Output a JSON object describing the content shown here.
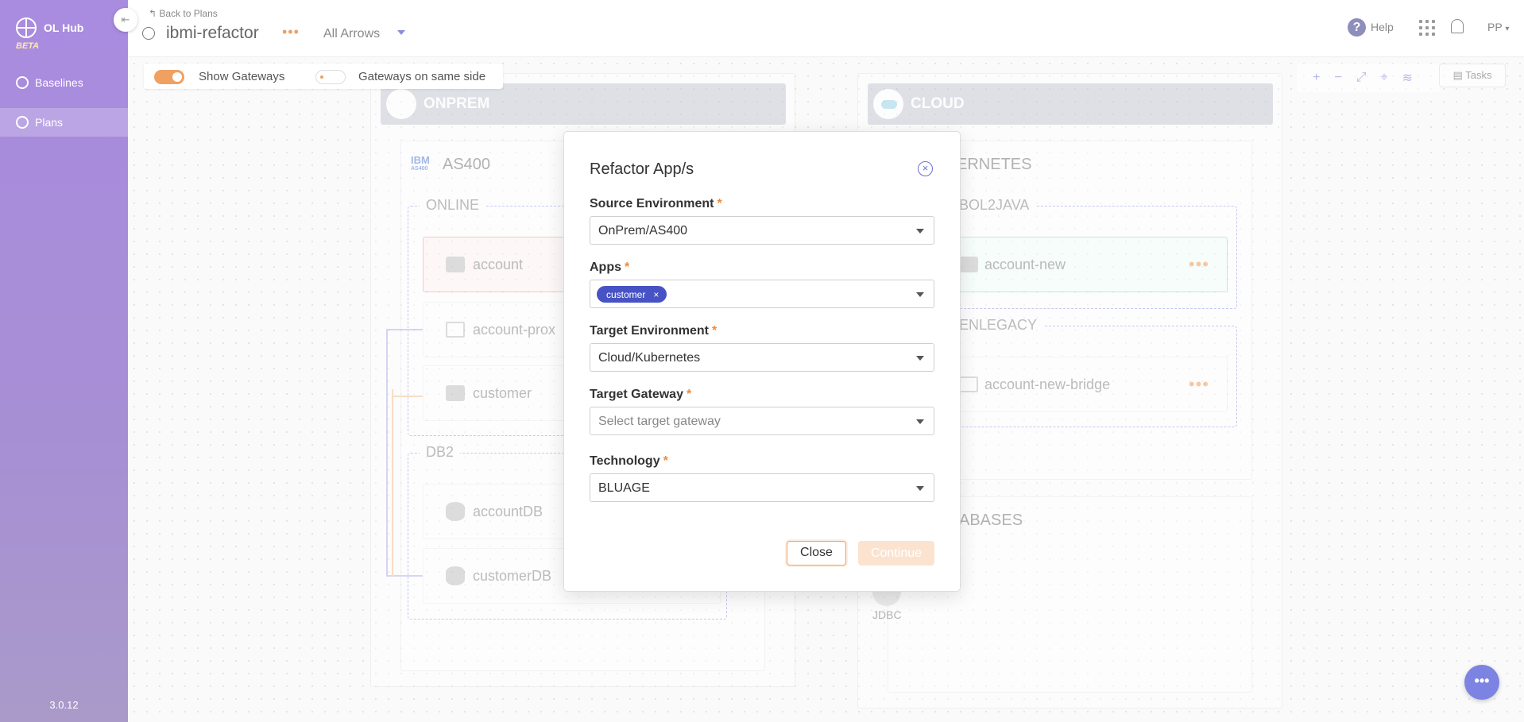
{
  "sidebar": {
    "brand_name": "OL Hub",
    "beta_label": "BETA",
    "items": [
      {
        "label": "Baselines",
        "active": false
      },
      {
        "label": "Plans",
        "active": true
      }
    ],
    "version": "3.0.12"
  },
  "header": {
    "back_link": "Back to Plans",
    "plan_title": "ibmi-refactor",
    "arrow_filter": "All Arrows",
    "help_label": "Help",
    "user_initials": "PP"
  },
  "toolbar": {
    "show_gateways_label": "Show Gateways",
    "show_gateways_on": true,
    "same_side_label": "Gateways on same side",
    "same_side_on": false,
    "tasks_label": "Tasks"
  },
  "diagram": {
    "onprem": {
      "label": "ONPREM",
      "platform": "AS400",
      "groups": [
        {
          "label": "ONLINE",
          "apps": [
            "account",
            "account-prox",
            "customer"
          ]
        },
        {
          "label": "DB2",
          "apps": [
            "accountDB",
            "customerDB"
          ]
        }
      ]
    },
    "cloud": {
      "label": "CLOUD",
      "platform_partial": "ERNETES",
      "groups": [
        {
          "label": "BOL2JAVA",
          "apps": [
            "account-new"
          ]
        },
        {
          "label": "ENLEGACY",
          "apps": [
            "account-new-bridge"
          ]
        }
      ],
      "databases_partial": "ABASES",
      "jdbc_label": "JDBC"
    },
    "ibm_logo_text": "IBM",
    "ibm_logo_subtext": "AS400"
  },
  "dialog": {
    "title": "Refactor App/s",
    "required_mark": "*",
    "source_env": {
      "label": "Source Environment",
      "value": "OnPrem/AS400"
    },
    "apps": {
      "label": "Apps",
      "chips": [
        "customer"
      ]
    },
    "target_env": {
      "label": "Target Environment",
      "value": "Cloud/Kubernetes"
    },
    "target_gateway": {
      "label": "Target Gateway",
      "placeholder": "Select target gateway"
    },
    "technology": {
      "label": "Technology",
      "value": "BLUAGE"
    },
    "close_label": "Close",
    "continue_label": "Continue"
  },
  "icons": {
    "back": "↰",
    "close": "×",
    "more": "•••",
    "fab": "•••",
    "help": "?",
    "zoom_in": "+",
    "zoom_out": "−",
    "fit": "⤢",
    "screenshot": "⌖",
    "layers": "≋",
    "tasks": "▤",
    "collapse": "⇤"
  },
  "colors": {
    "accent": "#f0a060",
    "primary": "#4753c4",
    "sidebar": "#a98be0"
  }
}
